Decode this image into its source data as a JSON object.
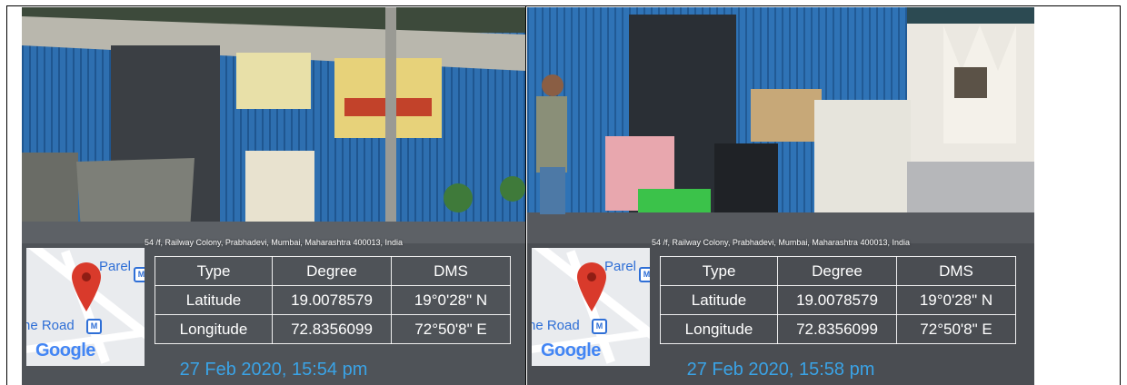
{
  "photos": [
    {
      "address": "54 /f, Railway Colony, Prabhadevi, Mumbai, Maharashtra 400013, India",
      "map": {
        "place": "Parel",
        "road": "ne Road",
        "brand": "Google",
        "pin_icon": "map-pin-icon",
        "transit_icon": "metro-station-icon"
      },
      "table": {
        "headers": [
          "Type",
          "Degree",
          "DMS"
        ],
        "rows": [
          [
            "Latitude",
            "19.0078579",
            "19°0'28\" N"
          ],
          [
            "Longitude",
            "72.8356099",
            "72°50'8\" E"
          ]
        ]
      },
      "timestamp": "27 Feb 2020, 15:54 pm"
    },
    {
      "address": "54 /f, Railway Colony, Prabhadevi, Mumbai, Maharashtra 400013, India",
      "map": {
        "place": "Parel",
        "road": "ne Road",
        "brand": "Google",
        "pin_icon": "map-pin-icon",
        "transit_icon": "metro-station-icon"
      },
      "table": {
        "headers": [
          "Type",
          "Degree",
          "DMS"
        ],
        "rows": [
          [
            "Latitude",
            "19.0078579",
            "19°0'28\" N"
          ],
          [
            "Longitude",
            "72.8356099",
            "72°50'8\" E"
          ]
        ]
      },
      "timestamp": "27 Feb 2020, 15:58 pm"
    }
  ],
  "colors": {
    "timestamp": "#3aa3e6",
    "map_text": "#2f6fd6",
    "pin": "#d93a2b"
  }
}
